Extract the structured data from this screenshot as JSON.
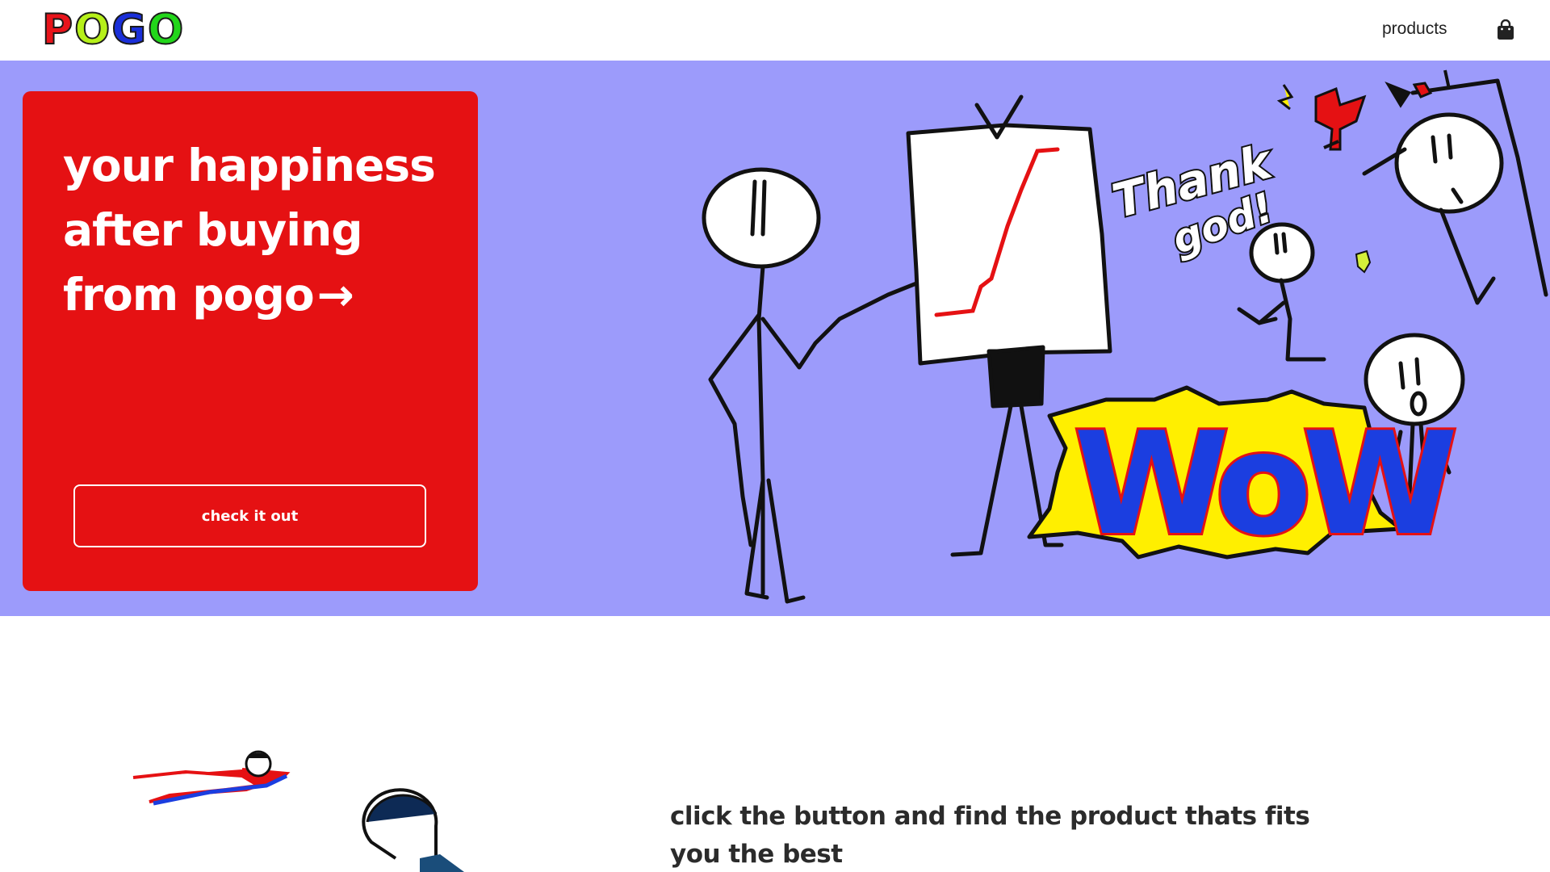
{
  "header": {
    "logo_letters": [
      "P",
      "O",
      "G",
      "O"
    ],
    "logo_colors": [
      "#e8141b",
      "#b6f01a",
      "#1a2fd9",
      "#22d61a"
    ],
    "nav_products": "products",
    "cart_icon": "shopping-bag-icon"
  },
  "hero": {
    "background": "#9c9bfb",
    "card_color": "#e51113",
    "title_lines": [
      "your happiness",
      "after buying",
      "from pogo"
    ],
    "arrow": "→",
    "cta_label": "check it out",
    "art_text_1": "Thank",
    "art_text_2": "god!",
    "art_wow": "WoW"
  },
  "lower": {
    "text": "click the button and find the product thats fits you the best"
  }
}
